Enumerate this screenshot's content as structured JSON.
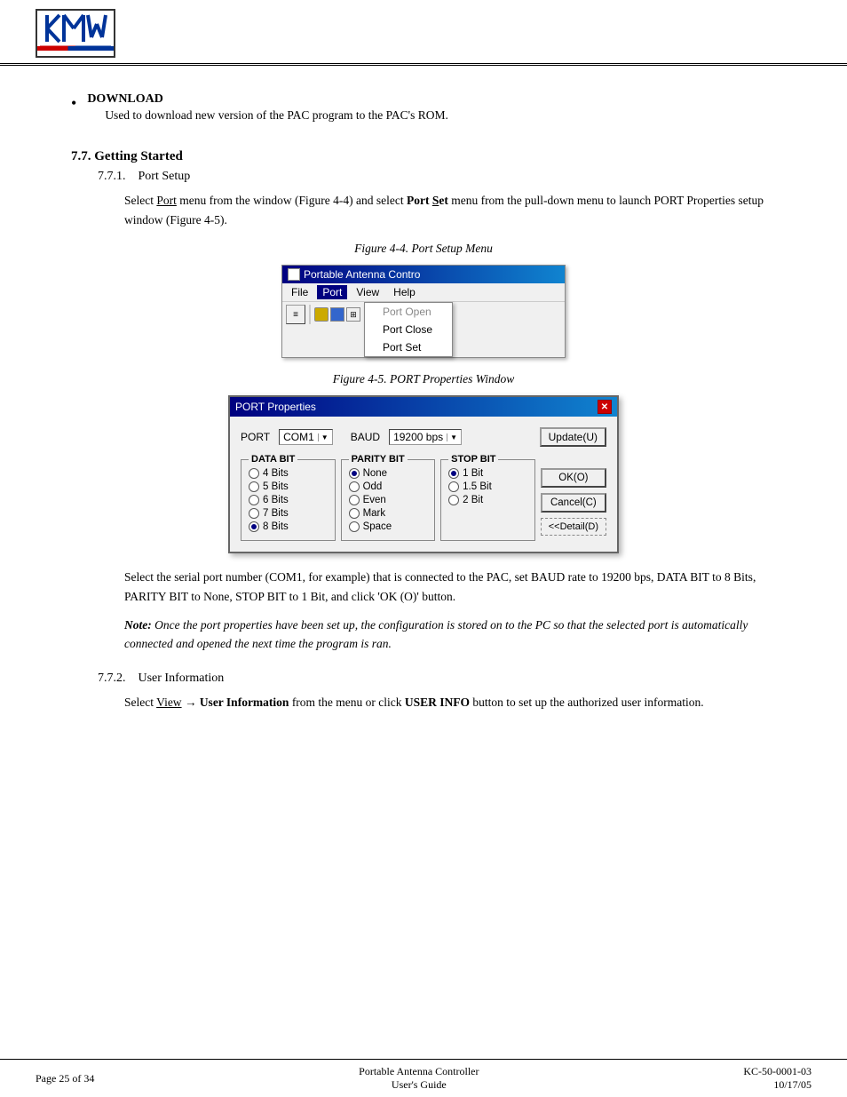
{
  "header": {
    "logo_text": "KMW"
  },
  "bullet": {
    "title": "DOWNLOAD",
    "description": "Used to download new version of the PAC program to the PAC's ROM."
  },
  "section_7_7": {
    "heading": "7.7.  Getting Started",
    "sub_7_7_1": {
      "label": "7.7.1.",
      "title": "Port Setup",
      "body": "Select Port menu from the window (Figure 4-4) and select Port Set menu from the pull-down menu to launch PORT Properties setup window (Figure 4-5).",
      "fig4_4_caption": "Figure 4-4. Port Setup Menu",
      "fig4_5_caption": "Figure 4-5. PORT Properties Window",
      "menu_window_title": "Portable Antenna Contro",
      "menu_items": [
        "File",
        "Port",
        "View",
        "Help"
      ],
      "port_menu_items": [
        "Port Open",
        "Port Close",
        "Port Set"
      ],
      "port_window_title": "PORT Properties",
      "port_label": "PORT",
      "port_value": "COM1",
      "baud_label": "BAUD",
      "baud_value": "19200 bps",
      "update_btn": "Update(U)",
      "data_bit_label": "DATA BIT",
      "data_bit_options": [
        "4 Bits",
        "5 Bits",
        "6 Bits",
        "7 Bits",
        "8 Bits"
      ],
      "data_bit_selected": "8 Bits",
      "parity_bit_label": "PARITY BIT",
      "parity_bit_options": [
        "None",
        "Odd",
        "Even",
        "Mark",
        "Space"
      ],
      "parity_bit_selected": "None",
      "stop_bit_label": "STOP BIT",
      "stop_bit_options": [
        "1 Bit",
        "1.5 Bit",
        "2 Bit"
      ],
      "stop_bit_selected": "1 Bit",
      "ok_btn": "OK(O)",
      "cancel_btn": "Cancel(C)",
      "detail_btn": "<<Detail(D)",
      "body2": "Select the serial port number (COM1, for example) that is connected to the PAC, set BAUD rate to 19200 bps, DATA BIT to 8 Bits, PARITY BIT to None, STOP BIT to 1 Bit, and click 'OK (O)' button.",
      "note": "Note: Once the port properties have been set up, the configuration is stored on to the PC so that the selected port is automatically connected and opened the next time the program is ran."
    },
    "sub_7_7_2": {
      "label": "7.7.2.",
      "title": "User Information",
      "body": "Select View → User Information from the menu or click USER INFO button to set up the authorized user information."
    }
  },
  "footer": {
    "left": "Page 25 of 34",
    "center_line1": "Portable Antenna Controller",
    "center_line2": "User's Guide",
    "right_line1": "KC-50-0001-03",
    "right_line2": "10/17/05"
  }
}
